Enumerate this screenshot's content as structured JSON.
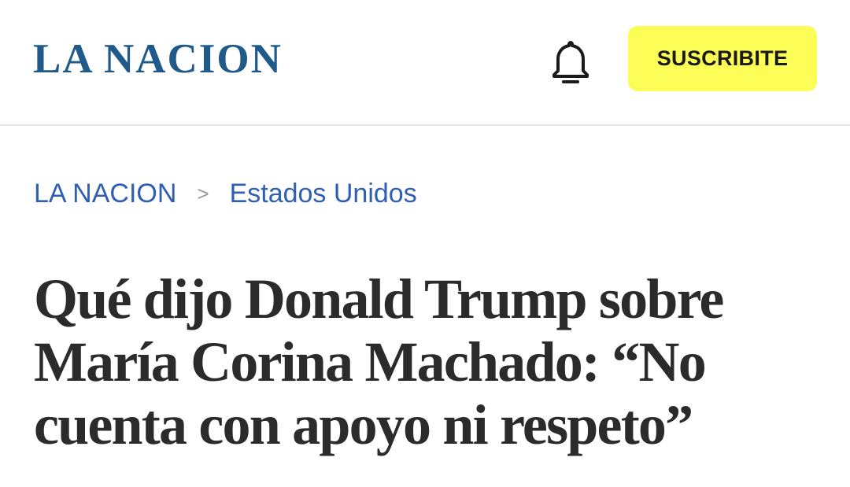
{
  "header": {
    "logo_text": "LA NACION",
    "notifications_icon": "bell-icon",
    "subscribe_label": "SUSCRIBITE"
  },
  "breadcrumb": {
    "items": [
      {
        "label": "LA NACION"
      },
      {
        "label": "Estados Unidos"
      }
    ],
    "separator": ">"
  },
  "article": {
    "headline": "Qué dijo Donald Trump sobre María Corina Machado: “No cuenta con apoyo ni respeto”"
  },
  "colors": {
    "brand": "#1f5a8a",
    "subscribe_bg": "#fdfd57",
    "link": "#2f5fb3",
    "headline": "#2b2b2b"
  }
}
